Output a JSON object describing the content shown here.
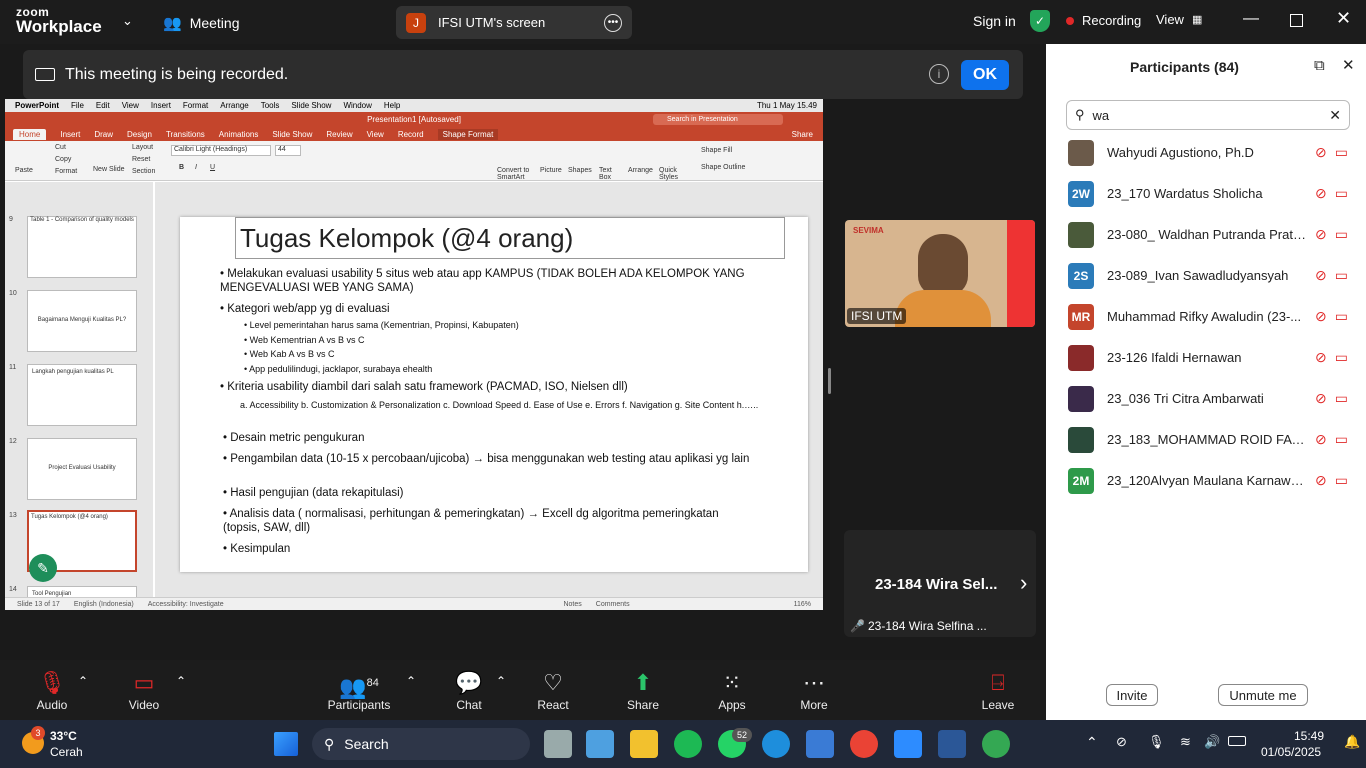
{
  "zoom": {
    "logo_top": "zoom",
    "logo_bottom": "Workplace",
    "meeting_label": "Meeting",
    "screen_initial": "J",
    "screen_title": "IFSI UTM's screen",
    "sign_in": "Sign in",
    "recording": "Recording",
    "view": "View",
    "banner_text": "This meeting is being recorded.",
    "ok": "OK"
  },
  "ppt": {
    "mac_menu": [
      "PowerPoint",
      "File",
      "Edit",
      "View",
      "Insert",
      "Format",
      "Arrange",
      "Tools",
      "Slide Show",
      "Window",
      "Help"
    ],
    "clock": "Thu 1 May  15.49",
    "doc_title": "Presentation1 [Autosaved]",
    "search_placeholder": "Search in Presentation",
    "share": "Share",
    "tabs": [
      "Home",
      "Insert",
      "Draw",
      "Design",
      "Transitions",
      "Animations",
      "Slide Show",
      "Review",
      "View",
      "Record",
      "Shape Format"
    ],
    "font": "Calibri Light (Headings)",
    "font_size": "44",
    "ribbon_labels": [
      "Paste",
      "Cut",
      "Copy",
      "Format",
      "New Slide",
      "Layout",
      "Reset",
      "Section",
      "Convert to SmartArt",
      "Picture",
      "Shapes",
      "Text Box",
      "Arrange",
      "Quick Styles",
      "Shape Fill",
      "Shape Outline"
    ],
    "thumbs": [
      {
        "num": "9",
        "text": "Table 1 - Comparison of quality models"
      },
      {
        "num": "10",
        "text": "Bagaimana Menguji Kualitas PL?"
      },
      {
        "num": "11",
        "text": "Langkah pengujian kualitas PL"
      },
      {
        "num": "12",
        "text": "Project Evaluasi Usability"
      },
      {
        "num": "13",
        "text": "Tugas Kelompok (@4 orang)"
      },
      {
        "num": "14",
        "text": "Tool Pengujian"
      }
    ],
    "slide_title": "Tugas Kelompok (@4 orang)",
    "bullets": [
      "Melakukan evaluasi usability 5 situs web atau app KAMPUS (TIDAK BOLEH ADA KELOMPOK YANG MENGEVALUASI WEB YANG SAMA)",
      "Kategori web/app yg di evaluasi",
      "Level pemerintahan harus sama (Kementrian, Propinsi, Kabupaten)",
      "Web Kementrian A vs B vs C",
      "Web Kab A vs B vs C",
      "App pedulilindugi, jacklapor, surabaya ehealth",
      "Kriteria usability diambil dari salah satu framework (PACMAD, ISO, Nielsen dll)",
      "a. Accessibility b. Customization & Personalization c. Download Speed d. Ease of Use e. Errors f. Navigation g. Site Content h.…..",
      "Desain metric pengukuran",
      "Pengambilan data (10-15 x percobaan/ujicoba) → bisa menggunakan web testing atau aplikasi yg lain",
      "Hasil pengujian (data rekapitulasi)",
      "Analisis data ( normalisasi, perhitungan & pemeringkatan) → Excell dg algoritma pemeringkatan (topsis, SAW, dll)",
      "Kesimpulan"
    ],
    "status_slide": "Slide 13 of 17",
    "status_lang": "English (Indonesia)",
    "status_access": "Accessibility: Investigate",
    "status_notes": "Notes",
    "status_comments": "Comments",
    "zoom_level": "116%"
  },
  "video": {
    "tile1_name": "IFSI UTM",
    "tile1_logo": "SEVIMA",
    "tile2_big": "23-184 Wira Sel...",
    "tile2_name": "23-184 Wira Selfina ..."
  },
  "participants": {
    "title": "Participants (84)",
    "search_value": "wa",
    "list": [
      {
        "initials": "",
        "name": "Wahyudi Agustiono, Ph.D",
        "color": "#6b5a4a"
      },
      {
        "initials": "2W",
        "name": "23_170 Wardatus Sholicha",
        "color": "#2b7bb9"
      },
      {
        "initials": "",
        "name": "23-080_ Waldhan Putranda Prata...",
        "color": "#4a5a3a"
      },
      {
        "initials": "2S",
        "name": "23-089_Ivan Sawadludyansyah",
        "color": "#2b7bb9"
      },
      {
        "initials": "MR",
        "name": "Muhammad Rifky Awaludin (23-...",
        "color": "#c4452c"
      },
      {
        "initials": "",
        "name": "23-126 Ifaldi Hernawan",
        "color": "#8a2a2a"
      },
      {
        "initials": "",
        "name": "23_036 Tri Citra Ambarwati",
        "color": "#3a2a4a"
      },
      {
        "initials": "",
        "name": "23_183_MOHAMMAD ROID FAW...",
        "color": "#2a4a3a"
      },
      {
        "initials": "2M",
        "name": "23_120Alvyan Maulana Karnawa...",
        "color": "#2e9a4a"
      }
    ],
    "invite": "Invite",
    "unmute_me": "Unmute me"
  },
  "toolbar": {
    "audio": "Audio",
    "video": "Video",
    "participants": "Participants",
    "participants_count": "84",
    "chat": "Chat",
    "react": "React",
    "share": "Share",
    "apps": "Apps",
    "more": "More",
    "leave": "Leave"
  },
  "taskbar": {
    "temp": "33°C",
    "weather": "Cerah",
    "weather_badge": "3",
    "search": "Search",
    "whatsapp_badge": "52",
    "time": "15:49",
    "date": "01/05/2025"
  }
}
